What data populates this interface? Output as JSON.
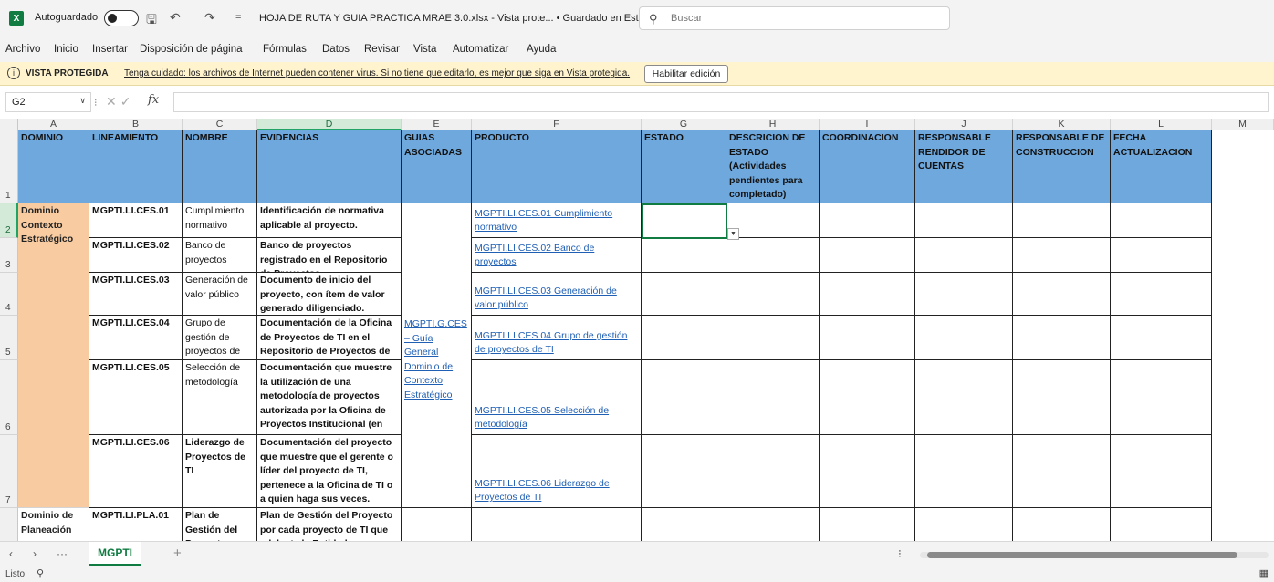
{
  "titlebar": {
    "logo": "X",
    "autosave_label": "Autoguardado",
    "doc_title": "HOJA DE RUTA Y GUIA PRACTICA MRAE 3.0.xlsx  -  Vista prote...  • Guardado en Este PC ∨",
    "search_placeholder": "Buscar"
  },
  "menu": [
    "Archivo",
    "Inicio",
    "Insertar",
    "Disposición de página",
    "Fórmulas",
    "Datos",
    "Revisar",
    "Vista",
    "Automatizar",
    "Ayuda"
  ],
  "banner": {
    "title": "VISTA PROTEGIDA",
    "message": "Tenga cuidado: los archivos de Internet pueden contener virus. Si no tiene que editarlo, es mejor que siga en Vista protegida.",
    "button": "Habilitar edición"
  },
  "formula_bar": {
    "name_box": "G2",
    "fx": "fx",
    "value": ""
  },
  "columns": [
    "A",
    "B",
    "C",
    "D",
    "E",
    "F",
    "G",
    "H",
    "I",
    "J",
    "K",
    "L",
    "M"
  ],
  "rows": [
    "1",
    "2",
    "3",
    "4",
    "5",
    "6",
    "7"
  ],
  "headers": {
    "dominio": "DOMINIO",
    "lineamiento": "LINEAMIENTO",
    "nombre": "NOMBRE",
    "evidencias": "EVIDENCIAS",
    "guias": "GUIAS ASOCIADAS",
    "producto": "PRODUCTO",
    "estado": "ESTADO",
    "descripcion": "DESCRICION DE ESTADO (Actividades pendientes para completado)",
    "coordinacion": "COORDINACION",
    "rendidor": "RESPONSABLE RENDIDOR DE CUENTAS",
    "construccion": "RESPONSABLE DE CONSTRUCCION",
    "fecha": "FECHA ACTUALIZACION"
  },
  "domains": {
    "ces": "Dominio Contexto Estratégico",
    "pla": "Dominio de Planeación"
  },
  "guia_ces": "MGPTI.G.CES – Guía General Dominio de Contexto Estratégico",
  "data_rows": [
    {
      "lineamiento": "MGPTI.LI.CES.01",
      "nombre": "Cumplimiento normativo",
      "evidencia": "Identificación de normativa aplicable al proyecto.",
      "producto": "MGPTI.LI.CES.01 Cumplimiento normativo"
    },
    {
      "lineamiento": "MGPTI.LI.CES.02",
      "nombre": "Banco de proyectos",
      "evidencia": "Banco de proyectos registrado en el Repositorio de Proyectos",
      "producto": "MGPTI.LI.CES.02 Banco de proyectos"
    },
    {
      "lineamiento": "MGPTI.LI.CES.03",
      "nombre": "Generación de valor público",
      "evidencia": "Documento de inicio del proyecto, con ítem de valor generado diligenciado.",
      "producto": "MGPTI.LI.CES.03 Generación de valor público"
    },
    {
      "lineamiento": "MGPTI.LI.CES.04",
      "nombre": "Grupo de gestión de proyectos de",
      "evidencia": "Documentación de la Oficina de Proyectos de TI en el Repositorio de Proyectos de la",
      "producto": "MGPTI.LI.CES.04 Grupo de gestión de proyectos de TI"
    },
    {
      "lineamiento": "MGPTI.LI.CES.05",
      "nombre": "Selección de metodología",
      "evidencia": "Documentación que muestre la utilización de una metodología de proyectos autorizada por la Oficina de Proyectos Institucional (en",
      "producto": "MGPTI.LI.CES.05 Selección de metodología"
    },
    {
      "lineamiento": "MGPTI.LI.CES.06",
      "nombre": "Liderazgo de Proyectos de TI",
      "evidencia": "Documentación del proyecto que muestre que el gerente o líder del proyecto de TI, pertenece a la Oficina de TI o a quien haga sus veces.",
      "producto": "MGPTI.LI.CES.06 Liderazgo de Proyectos de TI"
    },
    {
      "lineamiento": "MGPTI.LI.PLA.01",
      "nombre": "Plan de Gestión del Proyecto",
      "evidencia": "Plan de Gestión del Proyecto por cada proyecto de TI que adelante la Entidad",
      "producto": ""
    }
  ],
  "tabs": {
    "sheet": "MGPTI",
    "add": "+"
  },
  "status": {
    "text": "Listo"
  }
}
